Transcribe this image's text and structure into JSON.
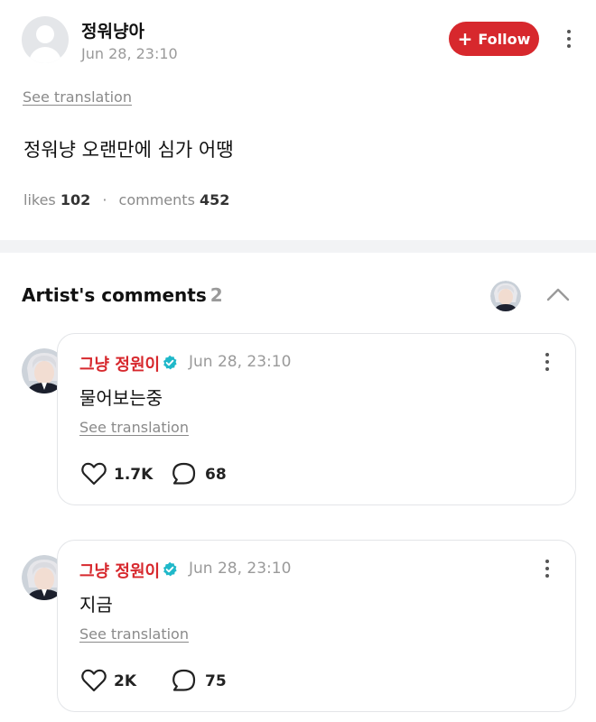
{
  "post": {
    "author": "정워냥아",
    "time": "Jun 28, 23:10",
    "follow_label": "Follow",
    "see_translation": "See translation",
    "body": "정워냥 오랜만에 심가 어땡",
    "likes_label": "likes",
    "likes_count": "102",
    "separator": "·",
    "comments_label": "comments",
    "comments_count": "452"
  },
  "artist_comments": {
    "title": "Artist's comments",
    "count": "2",
    "items": [
      {
        "name": "그냥 정원이",
        "time": "Jun 28, 23:10",
        "text": "물어보는중",
        "see_translation": "See translation",
        "likes": "1.7K",
        "replies": "68"
      },
      {
        "name": "그냥 정원이",
        "time": "Jun 28, 23:10",
        "text": "지금",
        "see_translation": "See translation",
        "likes": "2K",
        "replies": "75"
      }
    ]
  },
  "colors": {
    "accent": "#d7282d",
    "verified": "#1fb8c9",
    "muted": "#8a8a8a",
    "divider": "#f2f3f5"
  },
  "icons": [
    "user-placeholder-icon",
    "plus-icon",
    "more-vertical-icon",
    "chevron-up-icon",
    "verified-badge-icon",
    "heart-icon",
    "comment-bubble-icon"
  ]
}
